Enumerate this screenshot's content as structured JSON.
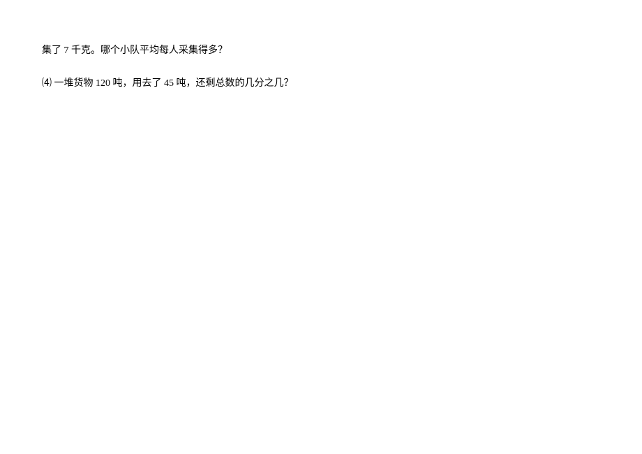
{
  "line1": "集了 7 千克。哪个小队平均每人采集得多？",
  "line2_number": "⑷",
  "line2_text": " 一堆货物 120 吨，用去了 45 吨，还剩总数的几分之几？"
}
